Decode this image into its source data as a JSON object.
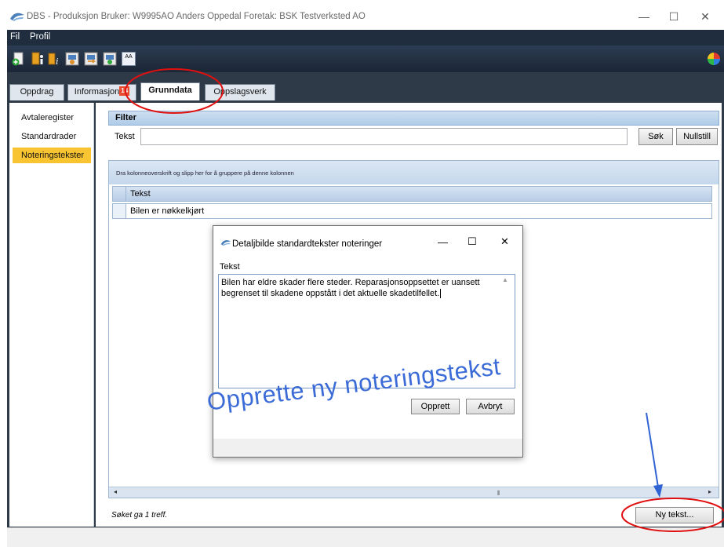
{
  "window": {
    "title": "DBS - Produksjon Bruker: W9995AO Anders Oppedal Foretak: BSK Testverksted AO",
    "minimize": "—",
    "maximize": "☐",
    "close": "✕"
  },
  "menu": {
    "items": [
      {
        "label": "Fil"
      },
      {
        "label": "Profil"
      }
    ]
  },
  "toolbar": {
    "icons": [
      "add-icon",
      "info-icon",
      "info-small-icon",
      "settings-icon",
      "export-icon",
      "import-icon",
      "font-icon"
    ],
    "font_icon_label": "AA"
  },
  "tabs": [
    {
      "label": "Oppdrag"
    },
    {
      "label": "Informasjon",
      "badge": "14"
    },
    {
      "label": "Grunndata",
      "active": true
    },
    {
      "label": "Oppslagsverk"
    }
  ],
  "sidebar": {
    "items": [
      {
        "label": "Avtaleregister"
      },
      {
        "label": "Standardrader"
      },
      {
        "label": "Noteringstekster",
        "selected": true
      }
    ]
  },
  "filter": {
    "title": "Filter",
    "label": "Tekst",
    "value": "",
    "search_label": "Søk",
    "reset_label": "Nullstill"
  },
  "grid": {
    "group_hint": "Dra kolonneoverskrift og slipp her for å gruppere på denne kolonnen",
    "column_header": "Tekst",
    "rows": [
      {
        "tekst": "Bilen er nøkkelkjørt"
      }
    ],
    "scroll_left": "◂",
    "scroll_thumb": "⦀",
    "scroll_right": "▸"
  },
  "status": {
    "text": "Søket ga 1 treff.",
    "new_button": "Ny tekst..."
  },
  "dialog": {
    "title": "Detaljbilde standardtekster noteringer",
    "minimize": "—",
    "maximize": "☐",
    "close": "✕",
    "label": "Tekst",
    "text": "Bilen har eldre skader flere steder. Reparasjonsoppsettet er uansett begrenset til skadene oppstått i det aktuelle skadetilfellet.",
    "scroll_hint": "▲",
    "ok_label": "Opprett",
    "cancel_label": "Avbryt"
  },
  "annotation": {
    "caption": "Opprette ny noteringstekst",
    "color": "#3b6bd6",
    "highlight_color": "#e01010"
  },
  "colors": {
    "accent_selected": "#f8c431",
    "dark_frame": "#2f3a48"
  }
}
